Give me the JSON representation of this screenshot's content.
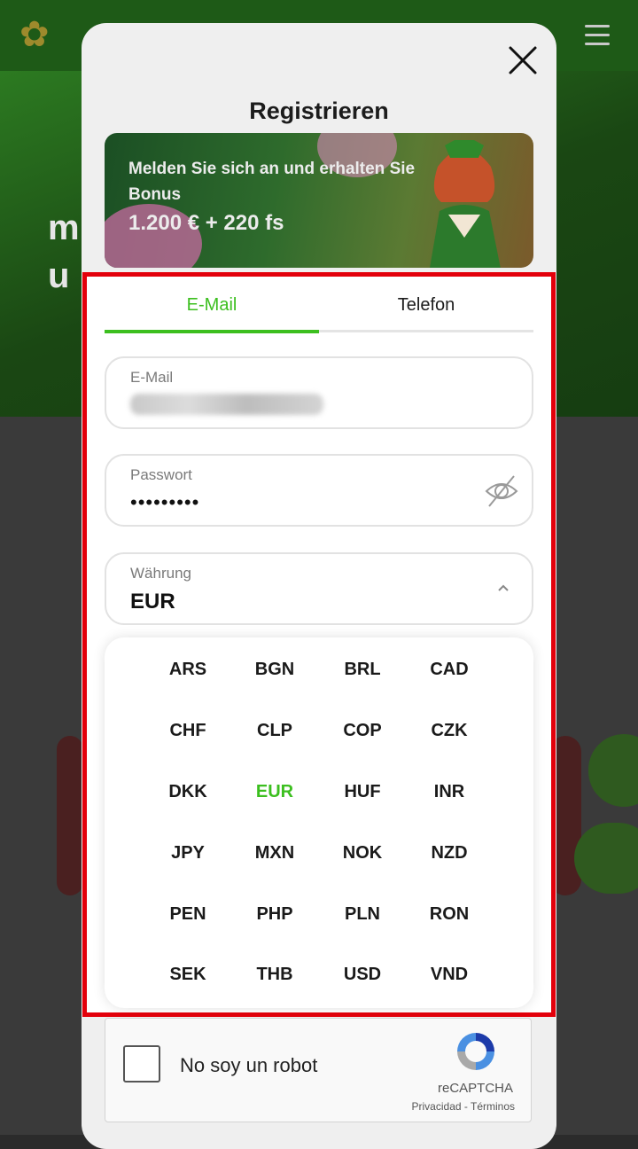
{
  "modal": {
    "title": "Registrieren",
    "promo": {
      "text": "Melden Sie sich an und erhalten Sie Bonus",
      "amount": "1.200 € + 220 fs"
    }
  },
  "tabs": [
    {
      "label": "E-Mail",
      "active": true
    },
    {
      "label": "Telefon",
      "active": false
    }
  ],
  "form": {
    "email_label": "E-Mail",
    "password_label": "Passwort",
    "password_value": "•••••••••",
    "currency_label": "Währung",
    "currency_value": "EUR"
  },
  "currencies": [
    "ARS",
    "BGN",
    "BRL",
    "CAD",
    "CHF",
    "CLP",
    "COP",
    "CZK",
    "DKK",
    "EUR",
    "HUF",
    "INR",
    "JPY",
    "MXN",
    "NOK",
    "NZD",
    "PEN",
    "PHP",
    "PLN",
    "RON",
    "SEK",
    "THB",
    "USD",
    "VND"
  ],
  "selected_currency": "EUR",
  "captcha": {
    "label": "No soy un robot",
    "brand": "reCAPTCHA",
    "terms": "Privacidad - Términos"
  },
  "colors": {
    "accent": "#3cbf1f",
    "highlight_border": "#e3000b"
  }
}
